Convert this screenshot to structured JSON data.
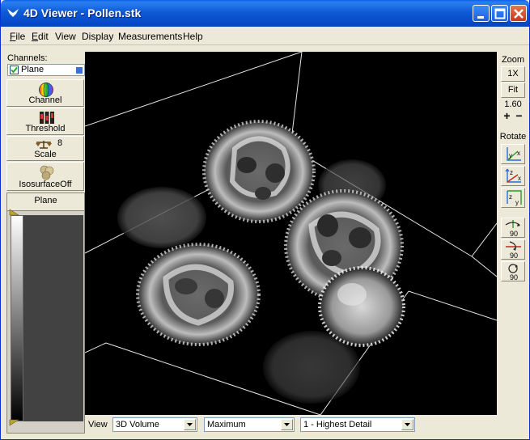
{
  "window": {
    "title": "4D Viewer - Pollen.stk"
  },
  "menu": [
    {
      "label": "File",
      "mnemonic": "F"
    },
    {
      "label": "Edit",
      "mnemonic": "E"
    },
    {
      "label": "View",
      "mnemonic": ""
    },
    {
      "label": "Display",
      "mnemonic": ""
    },
    {
      "label": "Measurements",
      "mnemonic": ""
    },
    {
      "label": "Help",
      "mnemonic": ""
    }
  ],
  "channels": {
    "label": "Channels:",
    "items": [
      {
        "name": "Plane",
        "checked": true,
        "color": "#3a6fd8"
      }
    ]
  },
  "tools": {
    "channel": {
      "label": "Channel",
      "icon": "color-wheel-icon"
    },
    "threshold": {
      "label": "Threshold",
      "icon": "threshold-icon"
    },
    "scale": {
      "label": "Scale",
      "value": "8",
      "icon": "balance-scale-icon"
    },
    "isosurface": {
      "label": "IsosurfaceOff",
      "icon": "isosurface-icon"
    }
  },
  "plane_panel": {
    "title": "Plane"
  },
  "zoom": {
    "label": "Zoom",
    "one_x": "1X",
    "fit": "Fit",
    "value": "1.60",
    "plus": "+",
    "minus": "−"
  },
  "rotate": {
    "label": "Rotate",
    "axis_buttons": [
      {
        "name": "rotate-xy-view",
        "axes": "x y"
      },
      {
        "name": "rotate-xz-view",
        "axes": "z x"
      },
      {
        "name": "rotate-zy-view",
        "axes": "z y"
      }
    ],
    "rot90_buttons": [
      {
        "label": "90",
        "icon": "rotate-90-horizontal-icon"
      },
      {
        "label": "90",
        "icon": "rotate-90-vertical-icon"
      },
      {
        "label": "90",
        "icon": "rotate-90-circular-icon"
      }
    ]
  },
  "bottom": {
    "view_label": "View",
    "view_mode": "3D Volume",
    "projection": "Maximum",
    "detail": "1 - Highest Detail"
  }
}
